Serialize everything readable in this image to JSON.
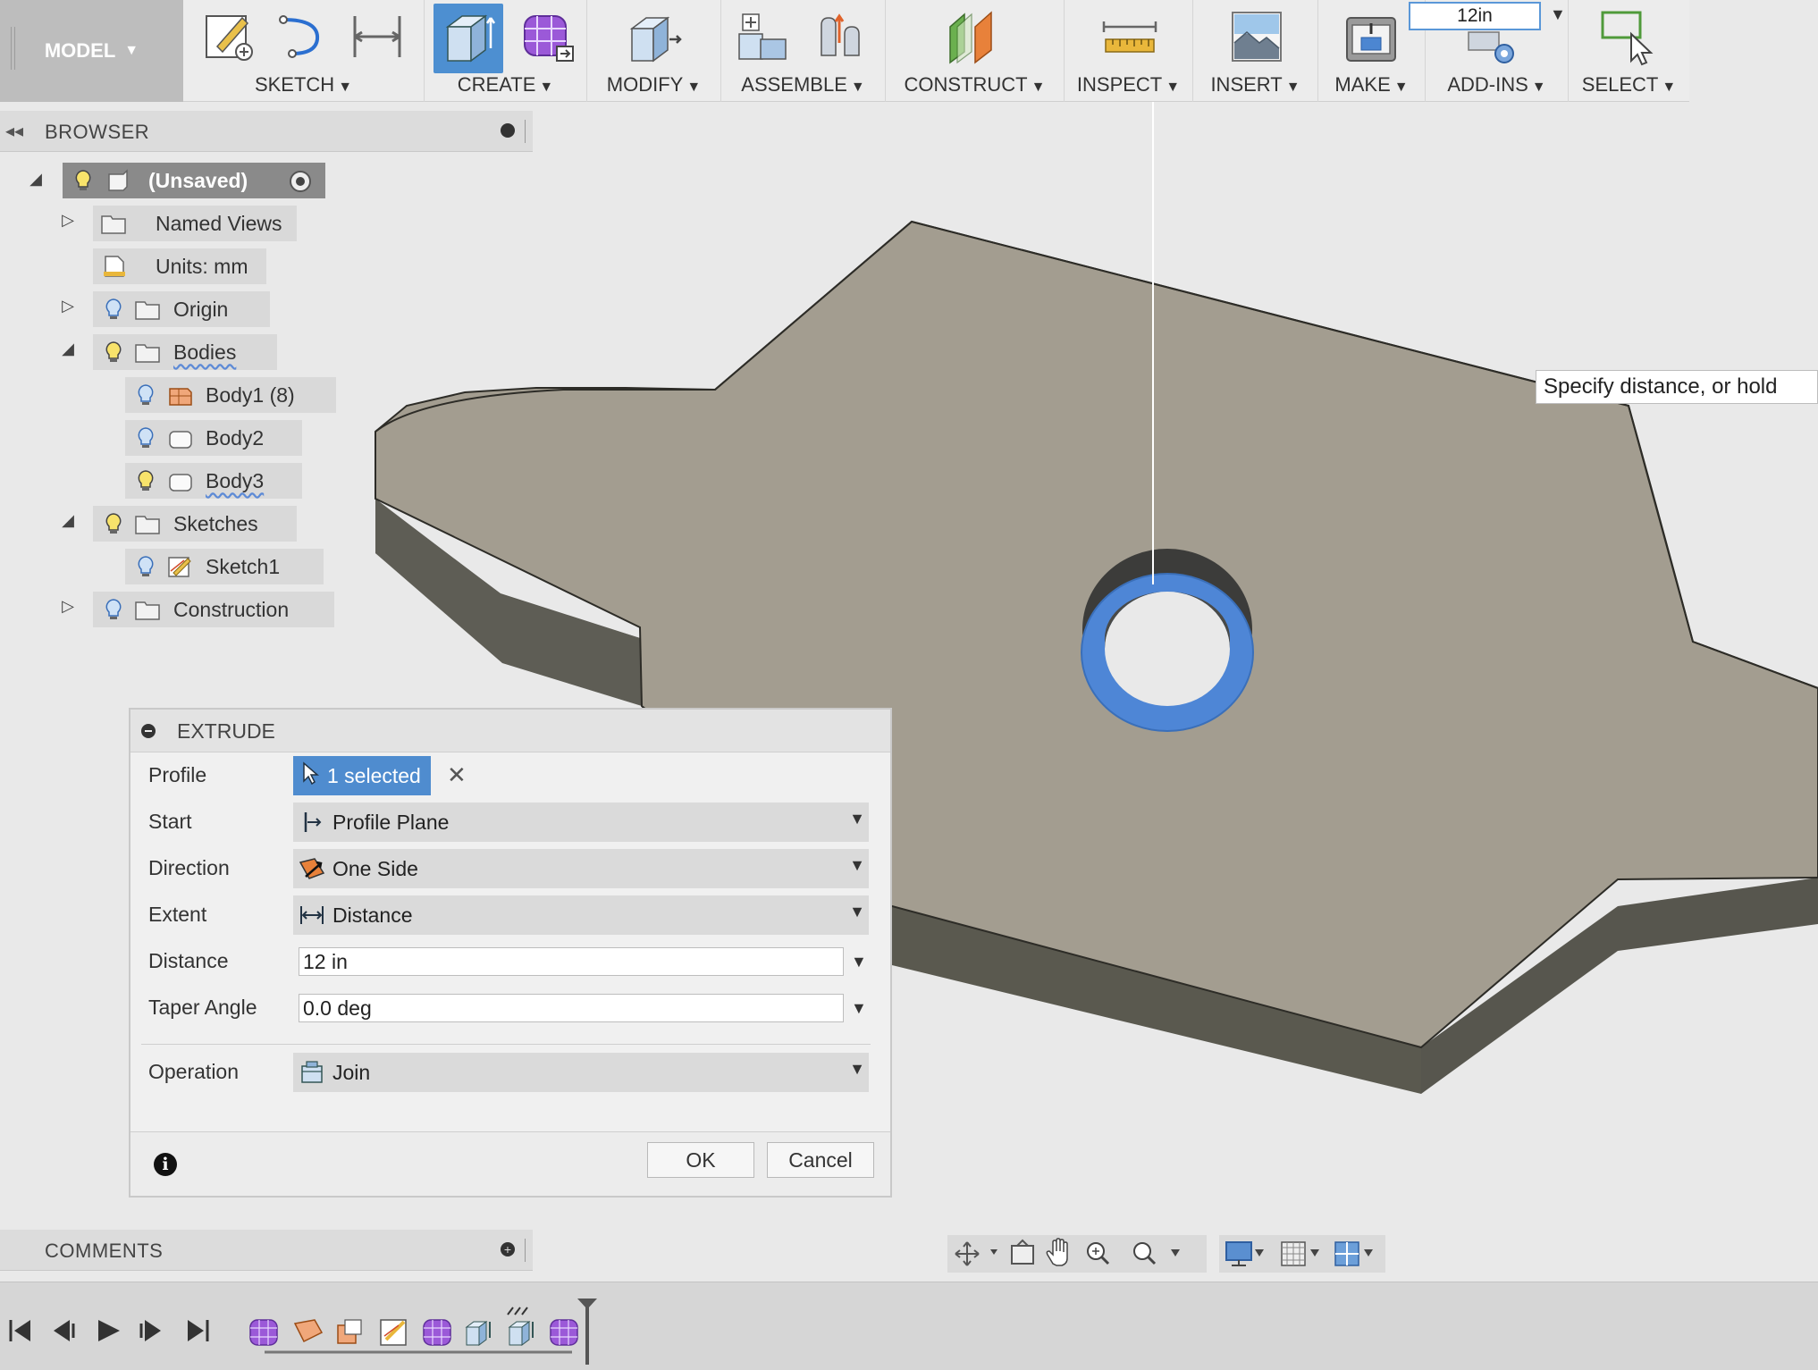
{
  "toolbar": {
    "mode": "MODEL",
    "groups": [
      {
        "id": "sketch",
        "label": "SKETCH"
      },
      {
        "id": "create",
        "label": "CREATE"
      },
      {
        "id": "modify",
        "label": "MODIFY"
      },
      {
        "id": "assemble",
        "label": "ASSEMBLE"
      },
      {
        "id": "construct",
        "label": "CONSTRUCT"
      },
      {
        "id": "inspect",
        "label": "INSPECT"
      },
      {
        "id": "insert",
        "label": "INSERT"
      },
      {
        "id": "make",
        "label": "MAKE"
      },
      {
        "id": "addins",
        "label": "ADD-INS"
      },
      {
        "id": "select",
        "label": "SELECT"
      }
    ],
    "distance_input": "12in"
  },
  "browser": {
    "title": "BROWSER",
    "root": "(Unsaved)",
    "items": [
      {
        "label": "Named Views"
      },
      {
        "label": "Units: mm"
      },
      {
        "label": "Origin"
      },
      {
        "label": "Bodies"
      },
      {
        "label": "Body1 (8)"
      },
      {
        "label": "Body2"
      },
      {
        "label": "Body3"
      },
      {
        "label": "Sketches"
      },
      {
        "label": "Sketch1"
      },
      {
        "label": "Construction"
      }
    ]
  },
  "tooltip": "Specify distance, or hold",
  "extrude": {
    "title": "EXTRUDE",
    "profile_label": "Profile",
    "profile_value": "1 selected",
    "start_label": "Start",
    "start_value": "Profile Plane",
    "direction_label": "Direction",
    "direction_value": "One Side",
    "extent_label": "Extent",
    "extent_value": "Distance",
    "distance_label": "Distance",
    "distance_value": "12 in",
    "taper_label": "Taper Angle",
    "taper_value": "0.0 deg",
    "operation_label": "Operation",
    "operation_value": "Join",
    "ok": "OK",
    "cancel": "Cancel"
  },
  "comments": {
    "title": "COMMENTS"
  },
  "colors": {
    "accent": "#4f8ccf",
    "model_face": "#a39d90",
    "model_side": "#5b5a52",
    "selection": "#4e86d6"
  }
}
